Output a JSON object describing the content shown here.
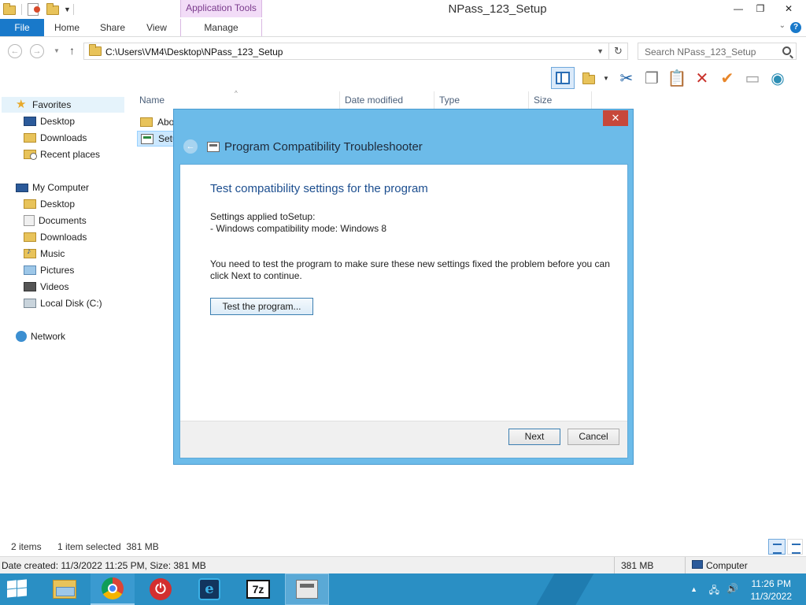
{
  "window": {
    "title": "NPass_123_Setup",
    "context_tab_group": "Application Tools",
    "minimize_glyph": "—",
    "maximize_glyph": "❐",
    "close_glyph": "✕"
  },
  "ribbon": {
    "tabs": [
      "File",
      "Home",
      "Share",
      "View",
      "Manage"
    ],
    "expand_glyph": "⌄",
    "help_glyph": "?"
  },
  "address_bar": {
    "back_glyph": "←",
    "forward_glyph": "→",
    "up_glyph": "↑",
    "path": "C:\\Users\\VM4\\Desktop\\NPass_123_Setup",
    "refresh_glyph": "↻",
    "search_placeholder": "Search NPass_123_Setup"
  },
  "toolbar": {
    "scissors_glyph": "✂",
    "copy_glyph": "❐",
    "paste_glyph": "📋",
    "delete_glyph": "✕",
    "check_glyph": "✔",
    "rename_glyph": "▭",
    "globe_glyph": "◉"
  },
  "nav_pane": {
    "favorites": {
      "label": "Favorites",
      "items": [
        "Desktop",
        "Downloads",
        "Recent places"
      ]
    },
    "computer": {
      "label": "My Computer",
      "items": [
        "Desktop",
        "Documents",
        "Downloads",
        "Music",
        "Pictures",
        "Videos",
        "Local Disk (C:)"
      ]
    },
    "network": {
      "label": "Network"
    }
  },
  "file_list": {
    "columns": [
      "Name",
      "Date modified",
      "Type",
      "Size"
    ],
    "sort_glyph": "^",
    "rows": [
      {
        "name": "Abo",
        "type": "folder"
      },
      {
        "name": "Setu",
        "type": "application",
        "selected": true
      }
    ]
  },
  "status_bar": {
    "items_count": "2 items",
    "selection": "1 item selected  381 MB"
  },
  "details_bar": {
    "info": "Date created: 11/3/2022 11:25 PM, Size: 381 MB",
    "size": "381 MB",
    "location": "Computer"
  },
  "dialog": {
    "title": "Program Compatibility Troubleshooter",
    "close_glyph": "✕",
    "back_glyph": "←",
    "heading": "Test compatibility settings for the program",
    "settings_label": "Settings applied toSetup:",
    "settings_value": "- Windows compatibility mode: Windows 8",
    "instruction_line1": "You need to test the program to make sure these new settings fixed the problem before you can",
    "instruction_line2": "click Next to continue.",
    "test_button": "Test the program...",
    "next_button": "Next",
    "cancel_button": "Cancel"
  },
  "taskbar": {
    "power_glyph": "⏻",
    "e_glyph": "e",
    "z_label": "7z",
    "tray_up_glyph": "▲",
    "network_glyph": "🖧",
    "volume_glyph": "🔊",
    "time": "11:26 PM",
    "date": "11/3/2022"
  },
  "colors": {
    "accent": "#1979ca",
    "dialog_frame": "#6cbbe9",
    "taskbar": "#2a8fc4",
    "dialog_heading": "#1c4e8f",
    "context_tab": "#f2dcf7"
  }
}
